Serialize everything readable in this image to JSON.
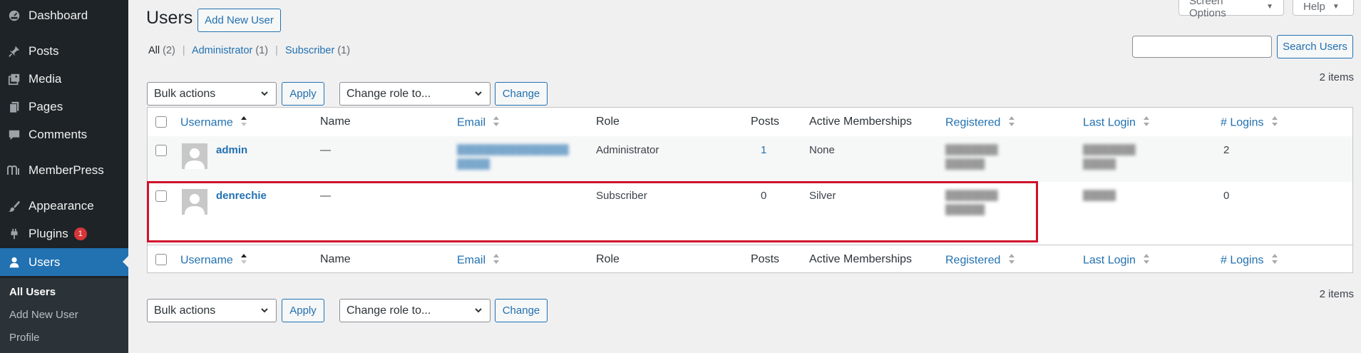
{
  "sidebar": {
    "items": [
      {
        "label": "Dashboard",
        "icon": "dashboard-icon"
      },
      {
        "label": "Posts",
        "icon": "pin-icon"
      },
      {
        "label": "Media",
        "icon": "media-icon"
      },
      {
        "label": "Pages",
        "icon": "pages-icon"
      },
      {
        "label": "Comments",
        "icon": "comment-icon"
      },
      {
        "label": "MemberPress",
        "icon": "memberpress-icon"
      },
      {
        "label": "Appearance",
        "icon": "brush-icon"
      },
      {
        "label": "Plugins",
        "icon": "plugin-icon",
        "badge": "1"
      },
      {
        "label": "Users",
        "icon": "user-icon",
        "active": true
      }
    ],
    "submenu": [
      "All Users",
      "Add New User",
      "Profile"
    ]
  },
  "header": {
    "title": "Users",
    "add_new_label": "Add New User",
    "screen_options_label": "Screen Options",
    "help_label": "Help"
  },
  "filters": {
    "all_label": "All",
    "all_count": "(2)",
    "admin_label": "Administrator",
    "admin_count": "(1)",
    "sub_label": "Subscriber",
    "sub_count": "(1)",
    "separator": "|"
  },
  "search": {
    "button_label": "Search Users",
    "value": ""
  },
  "actions": {
    "bulk_label": "Bulk actions",
    "apply_label": "Apply",
    "role_label": "Change role to...",
    "change_label": "Change",
    "items_count": "2 items"
  },
  "columns": {
    "username": "Username",
    "name": "Name",
    "email": "Email",
    "role": "Role",
    "posts": "Posts",
    "memberships": "Active Memberships",
    "registered": "Registered",
    "last_login": "Last Login",
    "logins": "# Logins"
  },
  "users": [
    {
      "username": "admin",
      "name": "—",
      "role": "Administrator",
      "posts": "1",
      "memberships": "None",
      "logins": "2"
    },
    {
      "username": "denrechie",
      "name": "—",
      "role": "Subscriber",
      "posts": "0",
      "memberships": "Silver",
      "logins": "0"
    }
  ],
  "colors": {
    "sidebar_bg": "#1d2327",
    "accent": "#2271b1",
    "highlight_border": "#d0112b",
    "badge": "#d63638"
  }
}
